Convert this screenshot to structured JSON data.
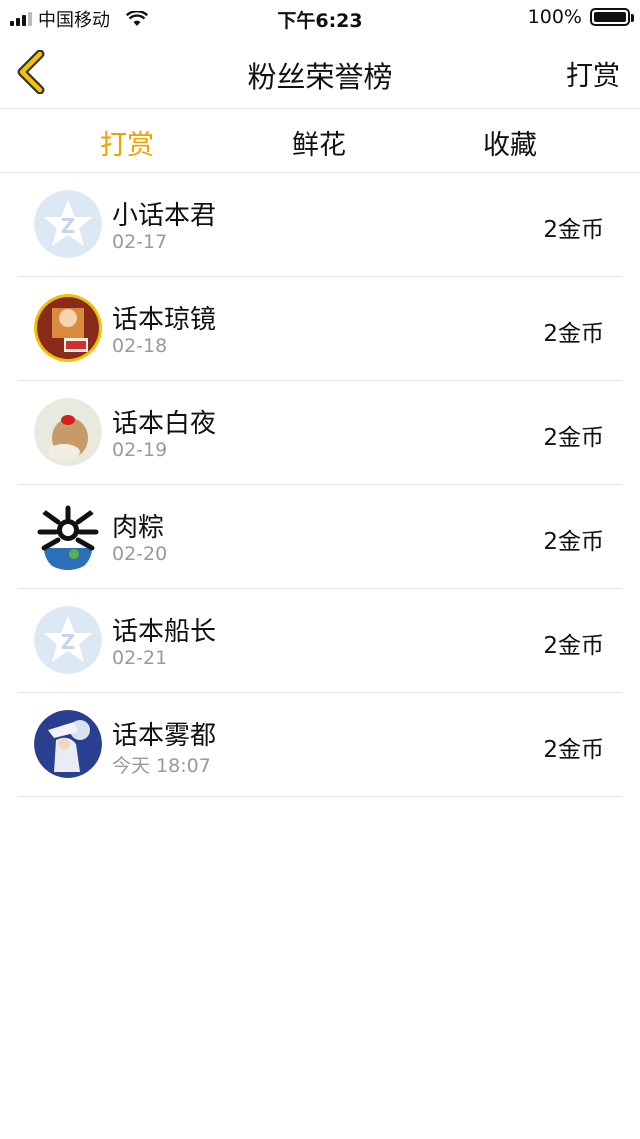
{
  "status_bar": {
    "carrier": "中国移动",
    "time": "下午6:23",
    "battery": "100%"
  },
  "nav": {
    "title": "粉丝荣誉榜",
    "right_action": "打赏",
    "back_icon": "chevron-left-icon",
    "accent_color": "#f0a000"
  },
  "tabs": [
    {
      "label": "打赏",
      "active": true
    },
    {
      "label": "鲜花",
      "active": false
    },
    {
      "label": "收藏",
      "active": false
    }
  ],
  "list": [
    {
      "name": "小话本君",
      "date": "02-17",
      "amount": "2金币",
      "avatar": "default-avatar-icon"
    },
    {
      "name": "话本琼镜",
      "date": "02-18",
      "amount": "2金币",
      "avatar": "user-avatar"
    },
    {
      "name": "话本白夜",
      "date": "02-19",
      "amount": "2金币",
      "avatar": "user-avatar"
    },
    {
      "name": "肉粽",
      "date": "02-20",
      "amount": "2金币",
      "avatar": "user-avatar"
    },
    {
      "name": "话本船长",
      "date": "02-21",
      "amount": "2金币",
      "avatar": "default-avatar-icon"
    },
    {
      "name": "话本雾都",
      "date": "今天 18:07",
      "amount": "2金币",
      "avatar": "user-avatar"
    }
  ]
}
